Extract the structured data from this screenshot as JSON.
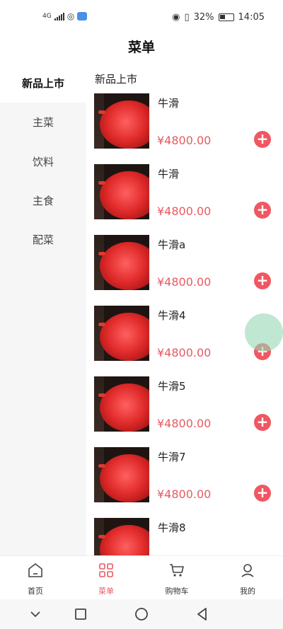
{
  "status": {
    "network": "4G",
    "battery": "32%",
    "time": "14:05"
  },
  "header": {
    "title": "菜单"
  },
  "sidebar": {
    "items": [
      {
        "label": "新品上市",
        "active": true
      },
      {
        "label": "主菜"
      },
      {
        "label": "饮料"
      },
      {
        "label": "主食"
      },
      {
        "label": "配菜"
      }
    ]
  },
  "main": {
    "section_title": "新品上市",
    "products": [
      {
        "name": "牛滑",
        "price": "¥4800.00"
      },
      {
        "name": "牛滑",
        "price": "¥4800.00"
      },
      {
        "name": "牛滑a",
        "price": "¥4800.00"
      },
      {
        "name": "牛滑4",
        "price": "¥4800.00"
      },
      {
        "name": "牛滑5",
        "price": "¥4800.00"
      },
      {
        "name": "牛滑7",
        "price": "¥4800.00"
      },
      {
        "name": "牛滑8",
        "price": ""
      }
    ],
    "add_symbol": "+"
  },
  "tabbar": {
    "tabs": [
      {
        "label": "首页",
        "icon": "home-icon"
      },
      {
        "label": "菜单",
        "icon": "grid-icon",
        "active": true
      },
      {
        "label": "购物车",
        "icon": "cart-icon"
      },
      {
        "label": "我的",
        "icon": "user-icon"
      }
    ]
  },
  "colors": {
    "accent": "#e85a5f",
    "add_button": "#f05762",
    "sidebar_bg": "#f6f6f6"
  }
}
